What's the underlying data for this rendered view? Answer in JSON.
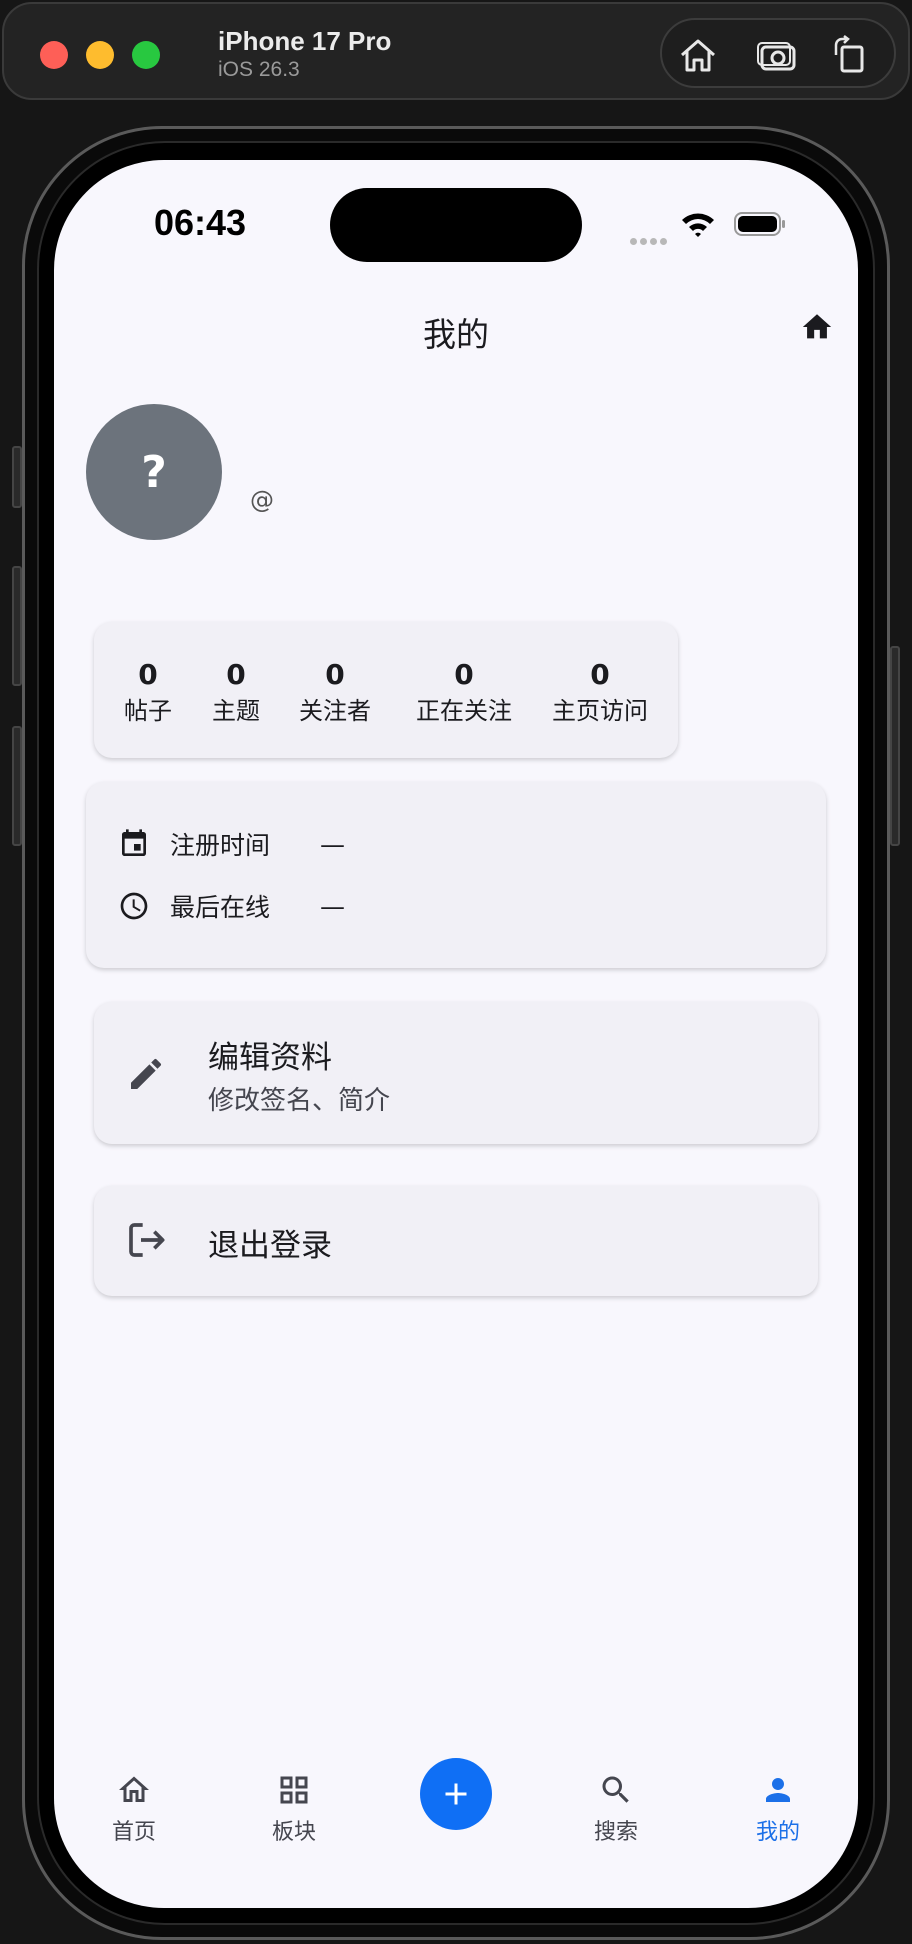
{
  "simulator": {
    "device_name": "iPhone 17 Pro",
    "os_version": "iOS 26.3",
    "tools": [
      "home-icon",
      "screenshot-icon",
      "rotate-icon"
    ]
  },
  "status_bar": {
    "time": "06:43"
  },
  "header": {
    "title": "我的",
    "action_icon": "home-icon"
  },
  "profile": {
    "avatar_text": "?",
    "handle": "@"
  },
  "stats": [
    {
      "value": "0",
      "label": "帖子"
    },
    {
      "value": "0",
      "label": "主题"
    },
    {
      "value": "0",
      "label": "关注者"
    },
    {
      "value": "0",
      "label": "正在关注"
    },
    {
      "value": "0",
      "label": "主页访问"
    }
  ],
  "info": [
    {
      "icon": "calendar-icon",
      "label": "注册时间",
      "value": "—"
    },
    {
      "icon": "clock-icon",
      "label": "最后在线",
      "value": "—"
    }
  ],
  "actions": {
    "edit": {
      "icon": "pencil-icon",
      "title": "编辑资料",
      "subtitle": "修改签名、简介"
    },
    "logout": {
      "icon": "logout-icon",
      "title": "退出登录"
    }
  },
  "tabbar": {
    "items": [
      {
        "icon": "home-icon",
        "label": "首页"
      },
      {
        "icon": "grid-icon",
        "label": "板块"
      },
      {
        "icon": "plus-icon",
        "label": ""
      },
      {
        "icon": "search-icon",
        "label": "搜索"
      },
      {
        "icon": "person-icon",
        "label": "我的"
      }
    ],
    "active_color": "#1c70e8",
    "fab_color": "#0f6ff5"
  }
}
